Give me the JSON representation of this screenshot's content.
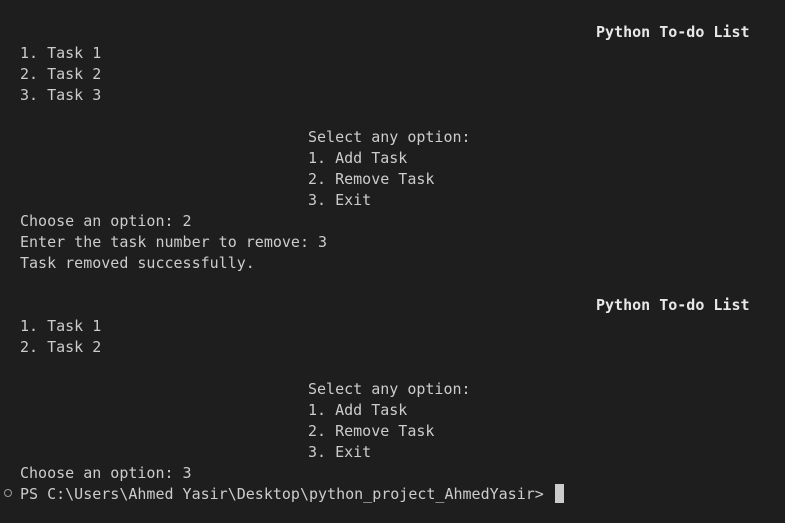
{
  "terminal": {
    "session1": {
      "title": "Python To-do List",
      "tasks": [
        "1. Task 1",
        "2. Task 2",
        "3. Task 3"
      ],
      "menu": [
        "Select any option:",
        "1. Add Task",
        "2. Remove Task",
        "3. Exit"
      ],
      "output": [
        "Choose an option: 2",
        "Enter the task number to remove: 3",
        "Task removed successfully."
      ]
    },
    "session2": {
      "title": "Python To-do List",
      "tasks": [
        "1. Task 1",
        "2. Task 2"
      ],
      "menu": [
        "Select any option:",
        "1. Add Task",
        "2. Remove Task",
        "3. Exit"
      ],
      "output": [
        "Choose an option: 3"
      ]
    },
    "prompt": "PS C:\\Users\\Ahmed Yasir\\Desktop\\python_project_AhmedYasir>"
  }
}
